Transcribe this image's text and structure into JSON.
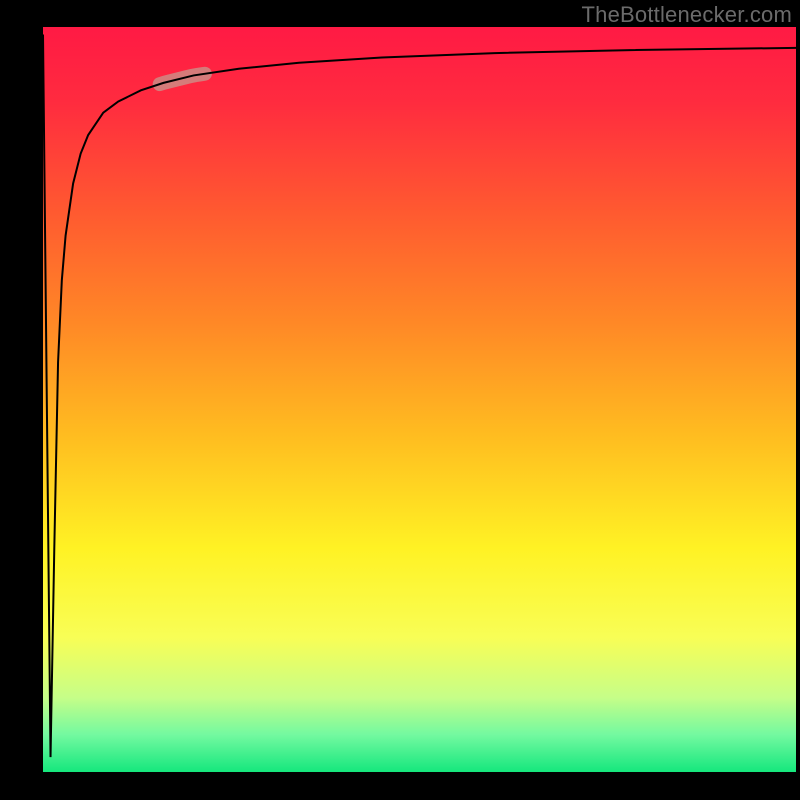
{
  "attribution": "TheBottlenecker.com",
  "colors": {
    "gradient_stops": [
      {
        "offset": 0.0,
        "color": "#ff1a44"
      },
      {
        "offset": 0.1,
        "color": "#ff2b3f"
      },
      {
        "offset": 0.25,
        "color": "#ff5a30"
      },
      {
        "offset": 0.4,
        "color": "#ff8926"
      },
      {
        "offset": 0.55,
        "color": "#ffbd20"
      },
      {
        "offset": 0.7,
        "color": "#fff224"
      },
      {
        "offset": 0.82,
        "color": "#f8fe56"
      },
      {
        "offset": 0.9,
        "color": "#c6fe88"
      },
      {
        "offset": 0.95,
        "color": "#73f9a0"
      },
      {
        "offset": 1.0,
        "color": "#15e77d"
      }
    ],
    "highlight": "#cc8f88",
    "curve": "#000000",
    "frame": "#000000",
    "attribution_text": "#6b6b6b"
  },
  "chart_data": {
    "type": "line",
    "title": "",
    "xlabel": "",
    "ylabel": "",
    "xlim": [
      0,
      100
    ],
    "ylim": [
      0,
      100
    ],
    "series": [
      {
        "name": "main-curve",
        "x": [
          0,
          1,
          1.5,
          2,
          2.5,
          3,
          4,
          5,
          6,
          8,
          10,
          13,
          16,
          20,
          26,
          34,
          45,
          60,
          78,
          100
        ],
        "values": [
          99,
          2,
          30,
          55,
          66,
          72,
          79,
          83,
          85.5,
          88.5,
          90,
          91.5,
          92.5,
          93.5,
          94.4,
          95.2,
          95.9,
          96.5,
          96.9,
          97.2
        ]
      }
    ],
    "highlight_segment": {
      "series": "main-curve",
      "x_range": [
        15.5,
        21.5
      ]
    },
    "legend": null,
    "grid": false
  }
}
